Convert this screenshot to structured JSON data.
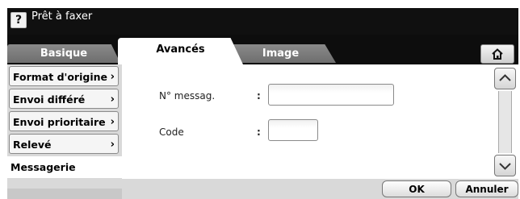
{
  "titlebar": {
    "help": "?",
    "status": "Prêt à faxer"
  },
  "tabs": [
    {
      "label": "Basique"
    },
    {
      "label": "Avancés"
    },
    {
      "label": "Image"
    }
  ],
  "menu": {
    "items": [
      {
        "label": "Format d'origine",
        "chevron": "›"
      },
      {
        "label": "Envoi différé",
        "chevron": "›"
      },
      {
        "label": "Envoi prioritaire",
        "chevron": "›"
      },
      {
        "label": "Relevé",
        "chevron": "›"
      },
      {
        "label": "Messagerie"
      }
    ]
  },
  "form": {
    "message_label": "N° messag.",
    "code_label": "Code",
    "colon": ":",
    "message_value": "",
    "code_value": ""
  },
  "buttons": {
    "ok": "OK",
    "cancel": "Annuler"
  },
  "colors": {
    "titlebar": "#101010",
    "menu_bg": "#d9d9d9",
    "tab_inactive": "#7a7a7a"
  }
}
